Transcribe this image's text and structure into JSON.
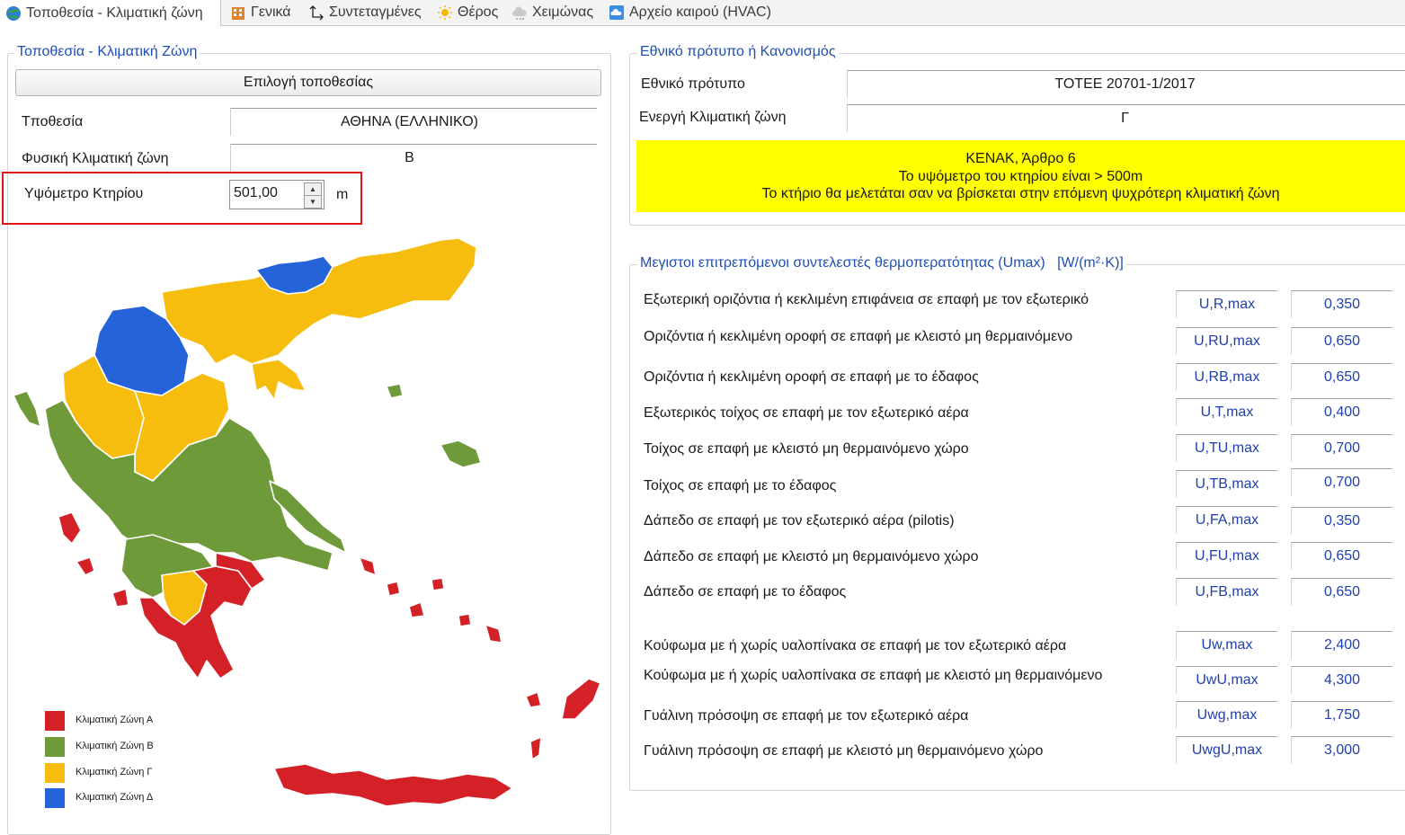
{
  "tabs": [
    {
      "label": "Τοποθεσία - Κλιματική ζώνη",
      "icon": "globe-icon"
    },
    {
      "label": "Γενικά",
      "icon": "building-icon"
    },
    {
      "label": "Συντεταγμένες",
      "icon": "axes-icon"
    },
    {
      "label": "Θέρος",
      "icon": "sun-icon"
    },
    {
      "label": "Χειμώνας",
      "icon": "cloud-icon"
    },
    {
      "label": "Αρχείο καιρού (HVAC)",
      "icon": "weather-file-icon"
    }
  ],
  "location": {
    "legend": "Τοποθεσία - Κλιματική Ζώνη",
    "select_button": "Επιλογή τοποθεσίας",
    "location_label": "Τποθεσία",
    "location_value": "ΑΘΗΝΑ (ΕΛΛΗΝΙΚΟ)",
    "zone_label": "Φυσική Κλιματική ζώνη",
    "zone_value": "Β",
    "altitude_label": "Υψόμετρο Κτηρίου",
    "altitude_value": "501,00",
    "altitude_unit": "m"
  },
  "map_legend": [
    {
      "label": "Κλιματική Ζώνη Α",
      "color": "#d42127"
    },
    {
      "label": "Κλιματική Ζώνη Β",
      "color": "#6e9a3a"
    },
    {
      "label": "Κλιματική Ζώνη Γ",
      "color": "#f6bd0f"
    },
    {
      "label": "Κλιματική Ζώνη Δ",
      "color": "#2563d9"
    }
  ],
  "standard": {
    "legend": "Εθνικό πρότυπο ή Κανονισμός",
    "standard_label": "Εθνικό πρότυπο",
    "standard_value": "ΤΟΤΕΕ 20701-1/2017",
    "active_zone_label": "Ενεργή Κλιματική ζώνη",
    "active_zone_value": "Γ",
    "note_lines": [
      "ΚΕΝΑΚ, Άρθρο 6",
      "Το υψόμετρο του κτηρίου είναι > 500m",
      "Το κτήριο θα μελετάται σαν να βρίσκεται στην επόμενη ψυχρότερη κλιματική ζώνη"
    ]
  },
  "umax": {
    "legend": "Μεγιστοι επιτρεπόμενοι συντελεστές θερμοπερατότητας (Umax)",
    "unit": "[W/(m²·K)]",
    "rows": [
      {
        "label": "Εξωτερική οριζόντια ή κεκλιμένη επιφάνεια σε επαφή με τον εξωτερικό",
        "symbol": "U,R,max",
        "value": "0,350"
      },
      {
        "label": "Οριζόντια ή κεκλιμένη οροφή σε επαφή με κλειστό μη θερμαινόμενο",
        "symbol": "U,RU,max",
        "value": "0,650"
      },
      {
        "label": "Οριζόντια ή κεκλιμένη οροφή σε επαφή με το έδαφος",
        "symbol": "U,RB,max",
        "value": "0,650"
      },
      {
        "label": "Εξωτερικός τοίχος σε επαφή με τον εξωτερικό αέρα",
        "symbol": "U,T,max",
        "value": "0,400"
      },
      {
        "label": "Τοίχος σε επαφή με κλειστό μη θερμαινόμενο χώρο",
        "symbol": "U,TU,max",
        "value": "0,700"
      },
      {
        "label": "Τοίχος σε επαφή με το έδαφος",
        "symbol": "U,TB,max",
        "value": "0,700"
      },
      {
        "label": "Δάπεδο σε επαφή με τον εξωτερικό αέρα (pilotis)",
        "symbol": "U,FA,max",
        "value": "0,350"
      },
      {
        "label": "Δάπεδο σε επαφή με κλειστό μη θερμαινόμενο χώρο",
        "symbol": "U,FU,max",
        "value": "0,650"
      },
      {
        "label": "Δάπεδο σε επαφή με το έδαφος",
        "symbol": "U,FB,max",
        "value": "0,650"
      },
      {
        "label": "Κούφωμα με ή χωρίς υαλοπίνακα σε επαφή με τον εξωτερικό αέρα",
        "symbol": "Uw,max",
        "value": "2,400"
      },
      {
        "label": "Κούφωμα με ή χωρίς υαλοπίνακα σε επαφή με κλειστό μη θερμαινόμενο",
        "symbol": "UwU,max",
        "value": "4,300"
      },
      {
        "label": "Γυάλινη πρόσοψη σε επαφή με τον εξωτερικό αέρα",
        "symbol": "Uwg,max",
        "value": "1,750"
      },
      {
        "label": "Γυάλινη πρόσοψη σε επαφή με κλειστό μη θερμαινόμενο χώρο",
        "symbol": "UwgU,max",
        "value": "3,000"
      }
    ]
  }
}
